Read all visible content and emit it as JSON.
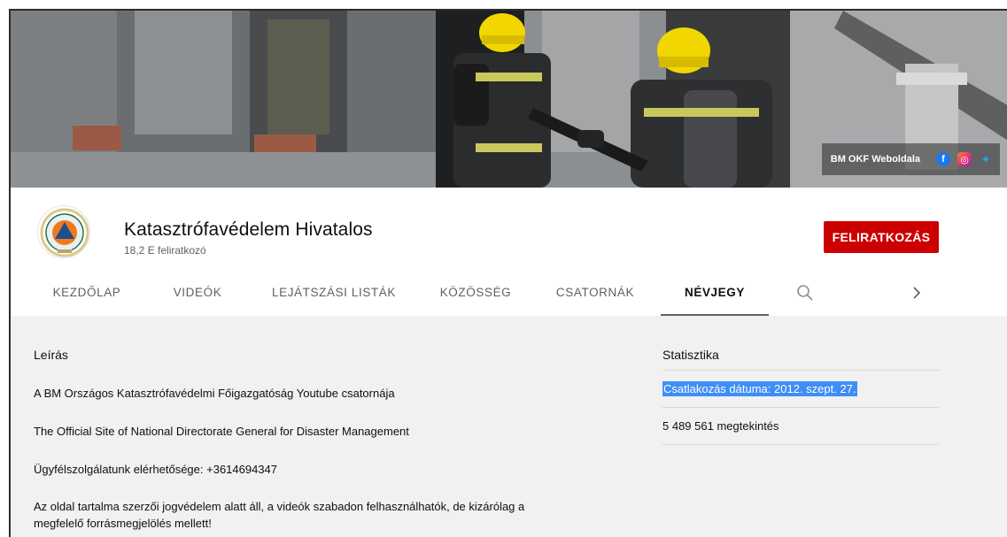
{
  "banner": {
    "link_text": "BM OKF Weboldala",
    "social_icons": [
      "facebook-icon",
      "instagram-icon",
      "twitter-icon"
    ]
  },
  "channel": {
    "title": "Katasztrófavédelem Hivatalos",
    "subscribers": "18,2 E feliratkozó",
    "subscribe_label": "FELIRATKOZÁS"
  },
  "tabs": [
    {
      "label": "KEZDŐLAP"
    },
    {
      "label": "VIDEÓK"
    },
    {
      "label": "LEJÁTSZÁSI LISTÁK"
    },
    {
      "label": "KÖZÖSSÉG"
    },
    {
      "label": "CSATORNÁK"
    },
    {
      "label": "NÉVJEGY"
    }
  ],
  "active_tab": "NÉVJEGY",
  "icons": {
    "search": "search-icon",
    "next": "chevron-right-icon"
  },
  "description": {
    "heading": "Leírás",
    "lines": [
      "A BM Országos Katasztrófavédelmi Főigazgatóság Youtube csatornája",
      "The Official Site of National Directorate General for Disaster Management",
      "Ügyfélszolgálatunk elérhetősége: +3614694347",
      "Az oldal tartalma szerzői jogvédelem alatt áll, a videók szabadon felhasználhatók, de kizárólag a",
      "megfelelő forrásmegjelölés mellett!"
    ]
  },
  "stats": {
    "heading": "Statisztika",
    "joined": "Csatlakozás dátuma: 2012. szept. 27.",
    "views": "5 489 561 megtekintés"
  },
  "colors": {
    "subscribe": "#cc0000",
    "selection": "#3e8ef5",
    "helmet": "#f2d600"
  }
}
